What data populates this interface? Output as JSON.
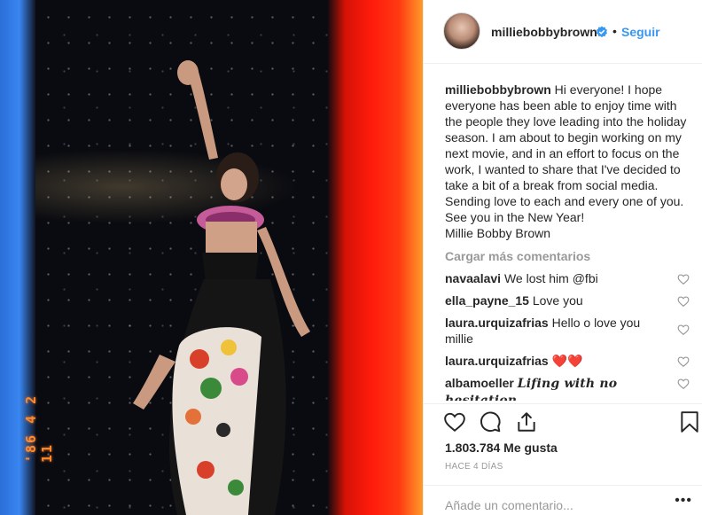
{
  "photo": {
    "date_stamp": "'86 4 2 11"
  },
  "header": {
    "username": "milliebobbybrown",
    "separator": "•",
    "follow_label": "Seguir"
  },
  "caption": {
    "username": "milliebobbybrown",
    "lines": [
      "Hi everyone! I hope everyone has been able to enjoy time with the people they love leading into the holiday season. I am about to begin working on my next movie, and in an effort to focus on the work, I wanted to share that I've decided to take a bit of a break from social media. Sending love to each and every one of you.",
      "See you in the New Year!",
      "Millie Bobby Brown"
    ]
  },
  "load_more_label": "Cargar más comentarios",
  "comments": [
    {
      "user": "navaalavi",
      "text": "We lost him @fbi"
    },
    {
      "user": "ella_payne_15",
      "text": "Love you"
    },
    {
      "user": "laura.urquizafrias",
      "text": "Hello o love you millie"
    },
    {
      "user": "laura.urquizafrias",
      "text": "❤️❤️"
    },
    {
      "user": "albamoeller",
      "text": "Lifing with no hesitation"
    }
  ],
  "likes": "1.803.784 Me gusta",
  "time_ago": "HACE 4 DÍAS",
  "add_comment": {
    "placeholder": "Añade un comentario...",
    "more_label": "•••"
  },
  "icons": {
    "verified": "verified-badge-icon",
    "like": "heart-icon",
    "comment": "comment-bubble-icon",
    "share": "share-icon",
    "save": "bookmark-icon"
  },
  "colors": {
    "link": "#3897f0",
    "text": "#262626",
    "muted": "#999999",
    "border": "#efefef"
  }
}
